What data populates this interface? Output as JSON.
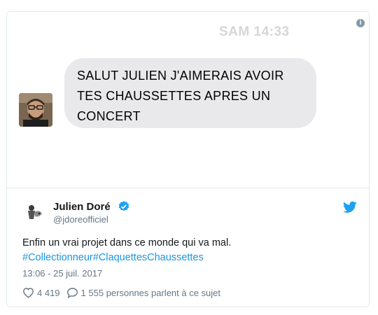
{
  "media": {
    "time": "SAM 14:33",
    "message": "SALUT JULIEN J'AIMERAIS AVOIR TES CHAUSSETTES APRES  UN CONCERT",
    "info_icon": "info-icon"
  },
  "tweet": {
    "name": "Julien Doré",
    "handle": "@jdoreofficiel",
    "text": "Enfin un vrai projet dans ce monde qui va mal.",
    "hashtag1": "#Collectionneur",
    "hashtag2": "#ClaquettesChaussettes",
    "date": "13:06 - 25 juil. 2017",
    "likes": "4 419",
    "replies": "1 555 personnes parlent à ce sujet"
  },
  "colors": {
    "link": "#1b95e0",
    "verified": "#1da1f2",
    "muted": "#657786",
    "bubble": "#e9e9eb"
  }
}
